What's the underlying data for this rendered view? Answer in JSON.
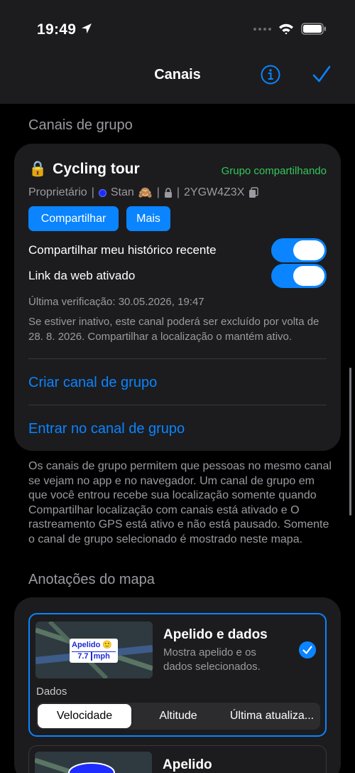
{
  "status_bar": {
    "time": "19:49"
  },
  "nav": {
    "title": "Canais"
  },
  "group_channels": {
    "header": "Canais de grupo",
    "channel": {
      "lock_emoji": "🔒",
      "name": "Cycling tour",
      "status": "Grupo compartilhando",
      "owner_label": "Proprietário",
      "owner_name": "Stan",
      "owner_emoji": "🙈",
      "code": "2YGW4Z3X",
      "share_button": "Compartilhar",
      "more_button": "Mais",
      "toggle_history_label": "Compartilhar meu histórico recente",
      "toggle_history_on": true,
      "toggle_web_label": "Link da web ativado",
      "toggle_web_on": true,
      "last_check": "Última verificação: 30.05.2026, 19:47",
      "inactive_note": "Se estiver inativo, este canal poderá ser excluído por volta de 28. 8. 2026. Compartilhar a localização o mantém ativo."
    },
    "create_link": "Criar canal de grupo",
    "join_link": "Entrar no canal de grupo",
    "footnote": "Os canais de grupo permitem que pessoas no mesmo canal se vejam no app e no navegador. Um canal de grupo em que você entrou recebe sua localização somente quando Compartilhar localização com canais está ativado e O rastreamento GPS está ativo e não está pausado. Somente o canal de grupo selecionado é mostrado neste mapa."
  },
  "map_annotations": {
    "header": "Anotações do mapa",
    "options": [
      {
        "title": "Apelido e dados",
        "description": "Mostra apelido e os dados selecionados.",
        "selected": true,
        "preview_name": "Apelido",
        "preview_emoji": "🙂",
        "preview_value": "7.7",
        "preview_unit": "mph",
        "data_label": "Dados",
        "segments": [
          "Velocidade",
          "Altitude",
          "Última atualiza..."
        ],
        "selected_segment": "Velocidade"
      },
      {
        "title": "Apelido",
        "selected": false
      }
    ]
  },
  "colors": {
    "accent": "#0a84ff",
    "status_green": "#32c759",
    "card_bg": "#1c1c1e",
    "secondary_text": "#9a9aa0"
  }
}
